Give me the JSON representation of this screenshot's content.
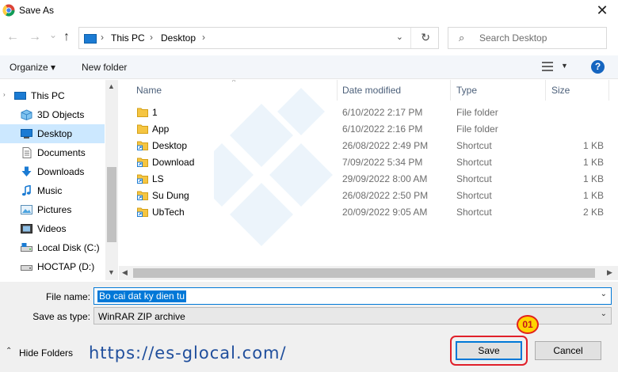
{
  "window": {
    "title": "Save As",
    "close_glyph": "✕",
    "icon": "chrome-icon"
  },
  "navigation": {
    "back_glyph": "←",
    "forward_glyph": "→",
    "recent_glyph": "⌄",
    "up_glyph": "↑",
    "address": [
      "This PC",
      "Desktop"
    ],
    "separator_glyph": "›",
    "dropdown_glyph": "⌄",
    "refresh_glyph": "↻",
    "search_placeholder": "Search Desktop",
    "search_glyph": "⌕"
  },
  "command_bar": {
    "organize_label": "Organize ▾",
    "new_folder_label": "New folder",
    "view_dropdown_glyph": "▼",
    "help_glyph": "?"
  },
  "sidebar": {
    "items": [
      {
        "label": "This PC",
        "icon": "pc-icon"
      },
      {
        "label": "3D Objects",
        "icon": "3d-objects-icon"
      },
      {
        "label": "Desktop",
        "icon": "desktop-icon",
        "selected": true
      },
      {
        "label": "Documents",
        "icon": "documents-icon"
      },
      {
        "label": "Downloads",
        "icon": "downloads-icon"
      },
      {
        "label": "Music",
        "icon": "music-icon"
      },
      {
        "label": "Pictures",
        "icon": "pictures-icon"
      },
      {
        "label": "Videos",
        "icon": "videos-icon"
      },
      {
        "label": "Local Disk (C:)",
        "icon": "drive-icon"
      },
      {
        "label": "HOCTAP (D:)",
        "icon": "drive-icon"
      }
    ],
    "scroll_up_glyph": "▲",
    "scroll_down_glyph": "▼"
  },
  "file_list": {
    "columns": [
      "Name",
      "Date modified",
      "Type",
      "Size"
    ],
    "sort_glyph": "^",
    "rows": [
      {
        "name": "1",
        "date": "6/10/2022 2:17 PM",
        "type": "File folder",
        "size": "",
        "kind": "folder"
      },
      {
        "name": "App",
        "date": "6/10/2022 2:16 PM",
        "type": "File folder",
        "size": "",
        "kind": "folder"
      },
      {
        "name": "Desktop",
        "date": "26/08/2022 2:49 PM",
        "type": "Shortcut",
        "size": "1 KB",
        "kind": "shortcut"
      },
      {
        "name": "Download",
        "date": "7/09/2022 5:34 PM",
        "type": "Shortcut",
        "size": "1 KB",
        "kind": "shortcut"
      },
      {
        "name": "LS",
        "date": "29/09/2022 8:00 AM",
        "type": "Shortcut",
        "size": "1 KB",
        "kind": "shortcut"
      },
      {
        "name": "Su Dung",
        "date": "26/08/2022 2:50 PM",
        "type": "Shortcut",
        "size": "1 KB",
        "kind": "shortcut"
      },
      {
        "name": "UbTech",
        "date": "20/09/2022 9:05 AM",
        "type": "Shortcut",
        "size": "2 KB",
        "kind": "shortcut"
      }
    ],
    "hscroll_left_glyph": "◀",
    "hscroll_right_glyph": "▶"
  },
  "form": {
    "file_name_label": "File name:",
    "file_name_value": "Bo cai dat ky dien tu",
    "save_type_label": "Save as type:",
    "save_type_value": "WinRAR ZIP archive",
    "dropdown_glyph": "⌄"
  },
  "footer": {
    "hide_folders_label": "Hide Folders",
    "hide_folders_glyph": "⌃",
    "website": "https://es-glocal.com/",
    "save_label": "Save",
    "cancel_label": "Cancel",
    "callout_number": "01"
  },
  "colors": {
    "accent": "#0078d7",
    "selection": "#cce8ff",
    "callout_red": "#e0202a",
    "callout_yellow": "#ffd400",
    "folder": "#f5c542"
  }
}
